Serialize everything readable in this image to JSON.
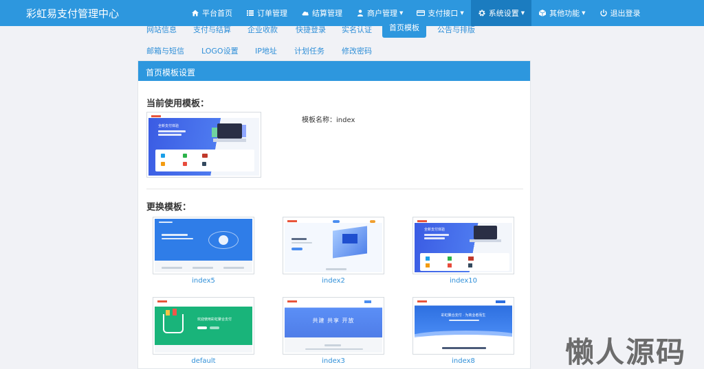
{
  "brand": "彩虹易支付管理中心",
  "nav": [
    {
      "label": "平台首页",
      "icon": "home-icon",
      "dropdown": false,
      "active": false
    },
    {
      "label": "订单管理",
      "icon": "list-icon",
      "dropdown": false,
      "active": false
    },
    {
      "label": "结算管理",
      "icon": "cloud-icon",
      "dropdown": false,
      "active": false
    },
    {
      "label": "商户管理",
      "icon": "user-icon",
      "dropdown": true,
      "active": false
    },
    {
      "label": "支付接口",
      "icon": "card-icon",
      "dropdown": true,
      "active": false
    },
    {
      "label": "系统设置",
      "icon": "gear-icon",
      "dropdown": true,
      "active": true
    },
    {
      "label": "其他功能",
      "icon": "cube-icon",
      "dropdown": true,
      "active": false
    },
    {
      "label": "退出登录",
      "icon": "power-icon",
      "dropdown": false,
      "active": false
    }
  ],
  "tabs_row1": [
    "网站信息",
    "支付与结算",
    "企业收款",
    "快捷登录",
    "实名认证",
    "首页模板",
    "公告与排版"
  ],
  "tabs_row2": [
    "邮箱与短信",
    "LOGO设置",
    "IP地址",
    "计划任务",
    "修改密码"
  ],
  "panel": {
    "title": "首页模板设置",
    "current_title": "当前使用模板：",
    "current_name_label": "模板名称：index",
    "change_title": "更换模板："
  },
  "templates": [
    {
      "name": "index5"
    },
    {
      "name": "index2"
    },
    {
      "name": "index10"
    },
    {
      "name": "default"
    },
    {
      "name": "index3"
    },
    {
      "name": "index8"
    }
  ],
  "thumb_text": {
    "current_hero": "全新支付体验",
    "index10_hero": "全新支付体验",
    "default_hero": "欢迎使用彩虹聚合支付",
    "index3_hero": "共建 共享 开放",
    "index8_hero": "彩虹聚合支付 · 为商业者而生"
  },
  "watermark": "懒人源码",
  "colors": {
    "primary": "#2d97de",
    "active_nav": "#1b7cc0",
    "link": "#2f8fd8"
  }
}
